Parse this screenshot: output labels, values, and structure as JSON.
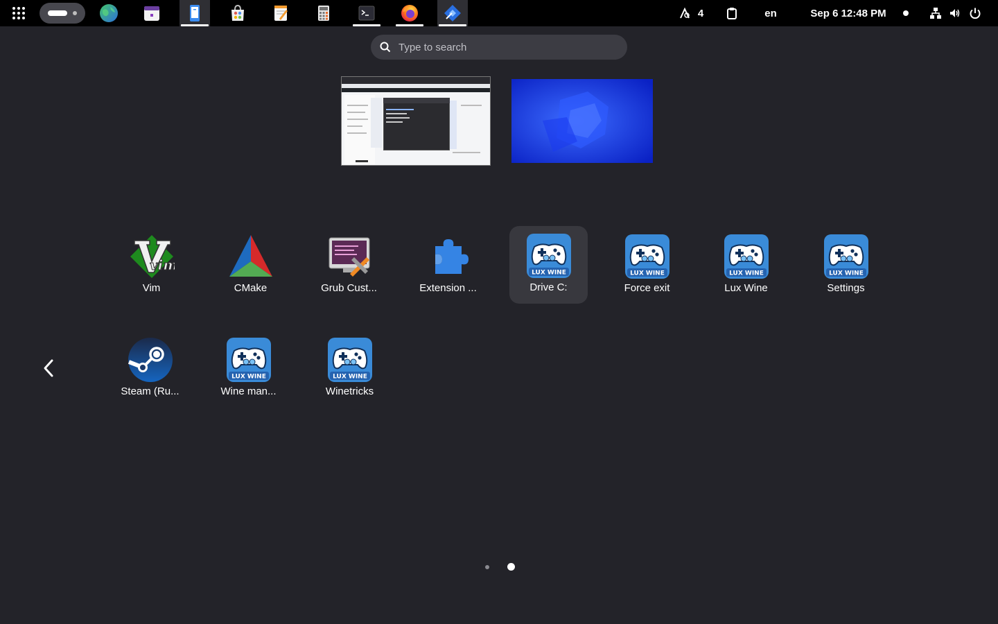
{
  "topbar": {
    "search_indicator_count": "4",
    "keyboard_layout": "en",
    "clock": "Sep 6  12:48 PM"
  },
  "search": {
    "placeholder": "Type to search"
  },
  "apps_page": [
    {
      "label": "Vim",
      "icon": "vim-icon"
    },
    {
      "label": "CMake",
      "icon": "cmake-icon"
    },
    {
      "label": "Grub Cust...",
      "icon": "grub-customizer-icon"
    },
    {
      "label": "Extension ...",
      "icon": "extension-puzzle-icon"
    },
    {
      "label": "Drive C:",
      "icon": "lux-wine-icon",
      "selected": true
    },
    {
      "label": "Force exit",
      "icon": "lux-wine-icon"
    },
    {
      "label": "Lux Wine",
      "icon": "lux-wine-icon"
    },
    {
      "label": "Settings",
      "icon": "lux-wine-icon"
    },
    {
      "label": "Steam (Ru...",
      "icon": "steam-icon"
    },
    {
      "label": "Wine man...",
      "icon": "lux-wine-icon"
    },
    {
      "label": "Winetricks",
      "icon": "lux-wine-icon"
    }
  ],
  "lux_wine_badge": "LUX WINE",
  "colors": {
    "background": "#232329",
    "topbar": "#000000",
    "selected_tile": "#38383e",
    "search_bg": "#3c3c43"
  },
  "pager": {
    "pages": 2,
    "current": 2
  }
}
